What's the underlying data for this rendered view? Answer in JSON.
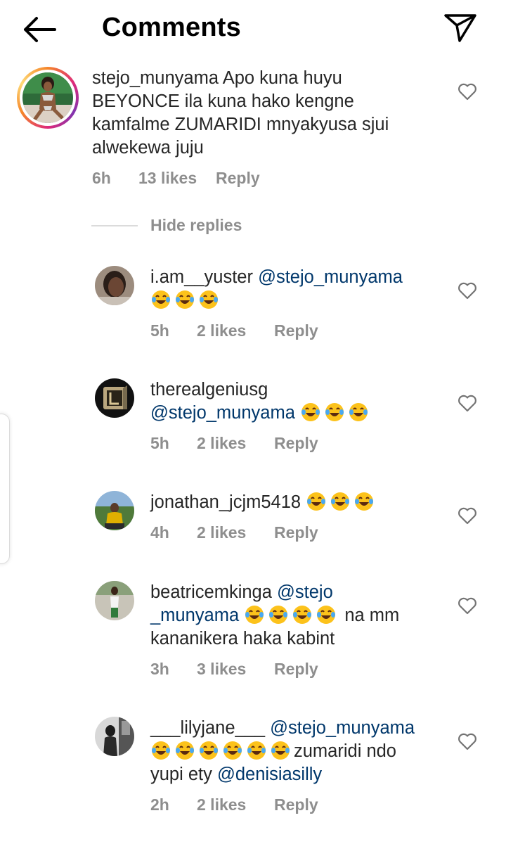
{
  "header": {
    "title": "Comments",
    "back_icon": "arrow-left-icon",
    "send_icon": "paper-plane-icon"
  },
  "main_comment": {
    "username": "stejo_munyama",
    "text": "Apo kuna huyu BEYONCE ila kuna hako kengne kamfalme ZUMARIDI mnyakyusa sjui alwekewa juju",
    "time": "6h",
    "likes": "13 likes",
    "reply": "Reply"
  },
  "hide_replies": "Hide replies",
  "replies": [
    {
      "username": "i.am__yuster",
      "mention": "@stejo_munyama",
      "time": "5h",
      "likes": "2 likes",
      "reply": "Reply"
    },
    {
      "username": "therealgeniusg",
      "mention": "@stejo_munyama",
      "time": "5h",
      "likes": "2 likes",
      "reply": "Reply"
    },
    {
      "username": "jonathan_jcjm5418",
      "time": "4h",
      "likes": "2 likes",
      "reply": "Reply"
    },
    {
      "username": "beatricemkinga",
      "mention_a": "@stejo",
      "mention_b": "_munyama",
      "text_after": "na mm",
      "text_line2": "kananikera haka kabint",
      "time": "3h",
      "likes": "3 likes",
      "reply": "Reply"
    },
    {
      "username": "___lilyjane___",
      "mention": "@stejo_munyama",
      "text_after": "zumaridi ndo",
      "text_line3_a": "yupi ety ",
      "mention2": "@denisiasilly",
      "time": "2h",
      "likes": "2 likes",
      "reply": "Reply"
    }
  ],
  "colors": {
    "mention": "#00376b",
    "meta": "#8e8e8e",
    "text": "#262626"
  },
  "emoji_name": "face-with-tears-of-joy"
}
